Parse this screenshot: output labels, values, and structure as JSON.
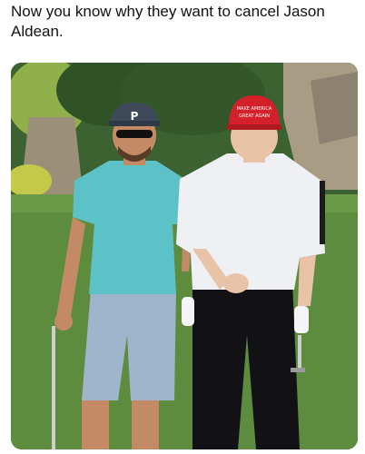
{
  "post": {
    "caption": "Now you know why they want to cancel Jason Aldean."
  },
  "photo": {
    "left_cap_logo": "P",
    "right_cap_text_line1": "MAKE AMERICA",
    "right_cap_text_line2": "GREAT AGAIN"
  },
  "colors": {
    "background": "#ffffff",
    "text": "#111111",
    "grass": "#5e8c3f",
    "hedge": "#355a2a",
    "rock": "#a99c85",
    "teal_shirt": "#5cc2c8",
    "white_shirt": "#eef0f4",
    "red_cap": "#d4202a"
  }
}
